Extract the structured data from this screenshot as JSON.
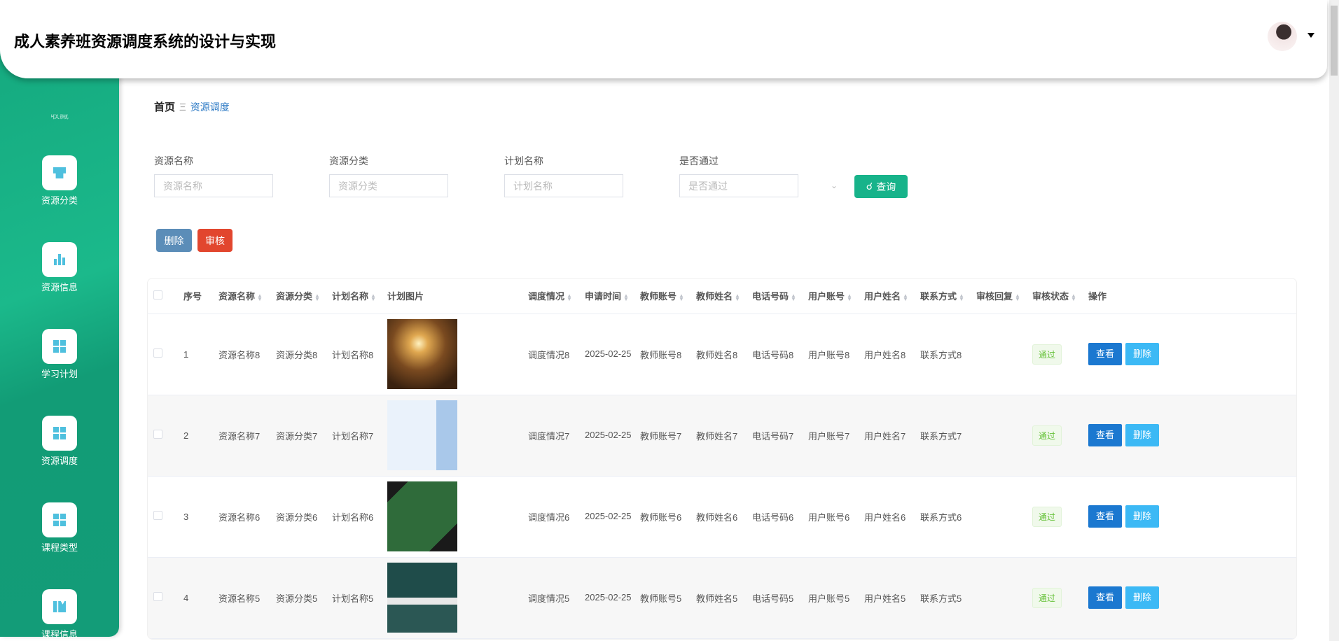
{
  "header": {
    "title": "成人素养班资源调度系统的设计与实现"
  },
  "sidebar": {
    "partial_label": "收藏",
    "items": [
      {
        "label": "资源分类",
        "icon": "store-icon"
      },
      {
        "label": "资源信息",
        "icon": "bar-chart-icon"
      },
      {
        "label": "学习计划",
        "icon": "grid-icon"
      },
      {
        "label": "资源调度",
        "icon": "grid-icon"
      },
      {
        "label": "课程类型",
        "icon": "grid-icon"
      },
      {
        "label": "课程信息",
        "icon": "book-icon"
      }
    ]
  },
  "breadcrumb": {
    "home": "首页",
    "sep": "Ξ",
    "current": "资源调度"
  },
  "search": {
    "fields": [
      {
        "label": "资源名称",
        "placeholder": "资源名称"
      },
      {
        "label": "资源分类",
        "placeholder": "资源分类"
      },
      {
        "label": "计划名称",
        "placeholder": "计划名称"
      },
      {
        "label": "是否通过",
        "placeholder": "是否通过"
      }
    ],
    "query_label": "查询"
  },
  "actions": {
    "delete": "删除",
    "audit": "审核"
  },
  "colors": {
    "primary": "#17b38a",
    "delete": "#5b8db8",
    "audit": "#e2462e",
    "view": "#1b78d0",
    "row_delete": "#3cb9f5"
  },
  "table": {
    "columns": [
      "序号",
      "资源名称",
      "资源分类",
      "计划名称",
      "计划图片",
      "调度情况",
      "申请时间",
      "教师账号",
      "教师姓名",
      "电话号码",
      "用户账号",
      "用户姓名",
      "联系方式",
      "审核回复",
      "审核状态",
      "操作"
    ],
    "rows": [
      {
        "index": "1",
        "name": "资源名称8",
        "category": "资源分类8",
        "plan": "计划名称8",
        "dispatch": "调度情况8",
        "date": "2025-02-25",
        "teacher_acc": "教师账号8",
        "teacher_name": "教师姓名8",
        "phone": "电话号码8",
        "user_acc": "用户账号8",
        "user_name": "用户姓名8",
        "contact": "联系方式8",
        "reply": "",
        "status": "通过",
        "view": "查看",
        "del": "删除"
      },
      {
        "index": "2",
        "name": "资源名称7",
        "category": "资源分类7",
        "plan": "计划名称7",
        "dispatch": "调度情况7",
        "date": "2025-02-25",
        "teacher_acc": "教师账号7",
        "teacher_name": "教师姓名7",
        "phone": "电话号码7",
        "user_acc": "用户账号7",
        "user_name": "用户姓名7",
        "contact": "联系方式7",
        "reply": "",
        "status": "通过",
        "view": "查看",
        "del": "删除"
      },
      {
        "index": "3",
        "name": "资源名称6",
        "category": "资源分类6",
        "plan": "计划名称6",
        "dispatch": "调度情况6",
        "date": "2025-02-25",
        "teacher_acc": "教师账号6",
        "teacher_name": "教师姓名6",
        "phone": "电话号码6",
        "user_acc": "用户账号6",
        "user_name": "用户姓名6",
        "contact": "联系方式6",
        "reply": "",
        "status": "通过",
        "view": "查看",
        "del": "删除"
      },
      {
        "index": "4",
        "name": "资源名称5",
        "category": "资源分类5",
        "plan": "计划名称5",
        "dispatch": "调度情况5",
        "date": "2025-02-25",
        "teacher_acc": "教师账号5",
        "teacher_name": "教师姓名5",
        "phone": "电话号码5",
        "user_acc": "用户账号5",
        "user_name": "用户姓名5",
        "contact": "联系方式5",
        "reply": "",
        "status": "通过",
        "view": "查看",
        "del": "删除"
      }
    ]
  }
}
